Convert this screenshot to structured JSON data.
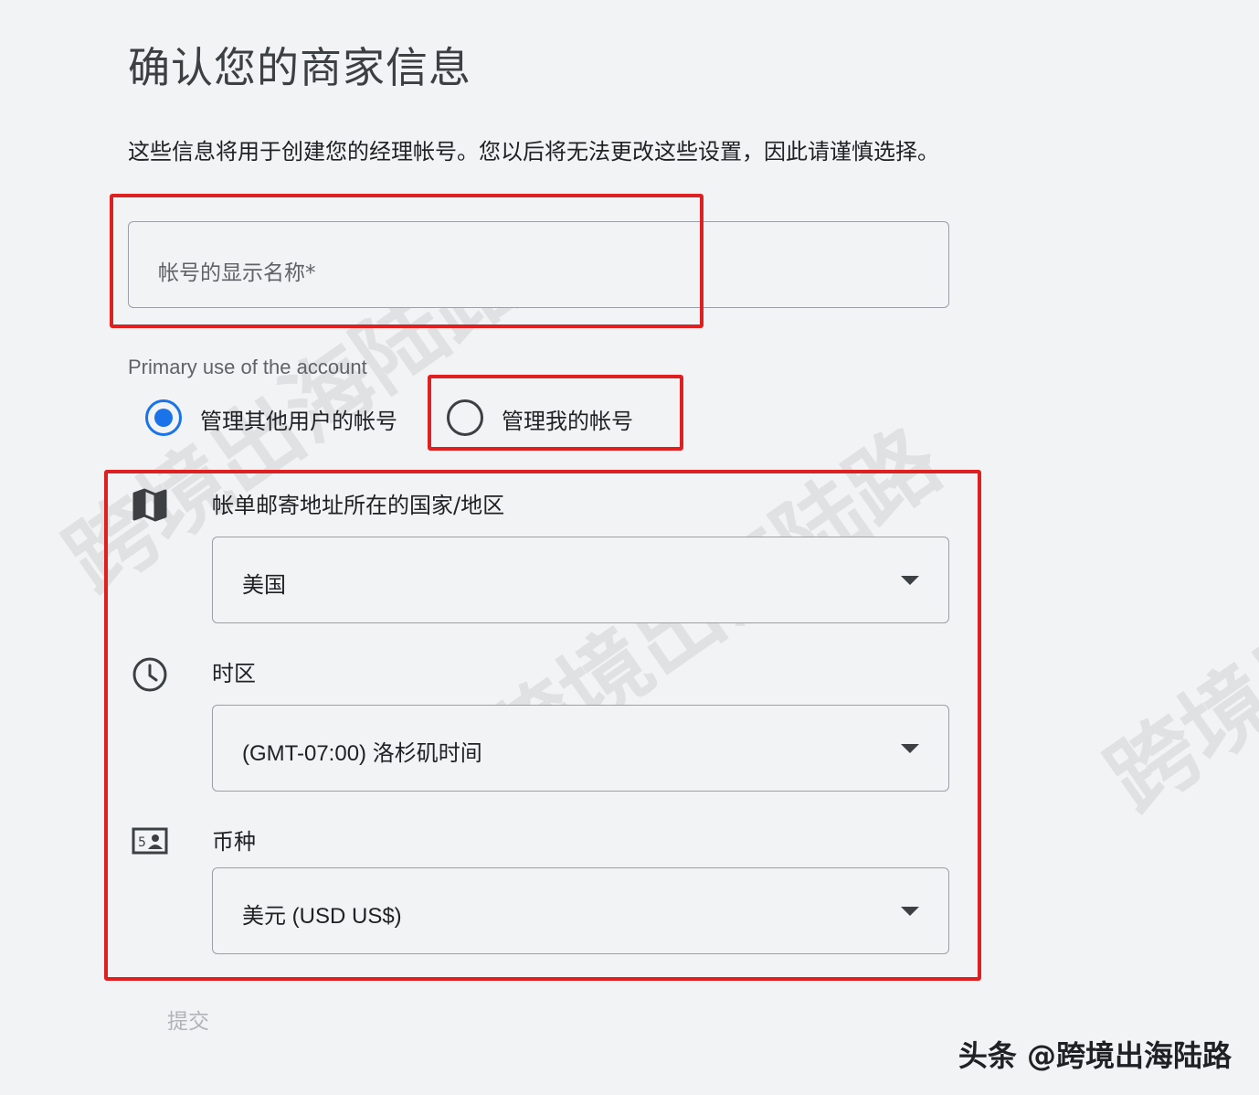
{
  "page": {
    "title": "确认您的商家信息",
    "description": "这些信息将用于创建您的经理帐号。您以后将无法更改这些设置，因此请谨慎选择。"
  },
  "account_name": {
    "placeholder": "帐号的显示名称*"
  },
  "primary_use": {
    "label": "Primary use of the account",
    "options": [
      {
        "label": "管理其他用户的帐号",
        "selected": true
      },
      {
        "label": "管理我的帐号",
        "selected": false
      }
    ]
  },
  "country": {
    "icon": "map-icon",
    "label": "帐单邮寄地址所在的国家/地区",
    "value": "美国"
  },
  "timezone": {
    "icon": "clock-icon",
    "label": "时区",
    "value": "(GMT-07:00) 洛杉矶时间"
  },
  "currency": {
    "icon": "currency-bill-icon",
    "label": "币种",
    "value": "美元 (USD US$)"
  },
  "submit": {
    "label": "提交"
  },
  "watermark": {
    "text": "跨境出海陆路"
  },
  "attribution": {
    "text": "头条 @跨境出海陆路"
  },
  "colors": {
    "accent": "#1a73e8",
    "highlight": "#e02020",
    "background": "#f1f3f4"
  }
}
